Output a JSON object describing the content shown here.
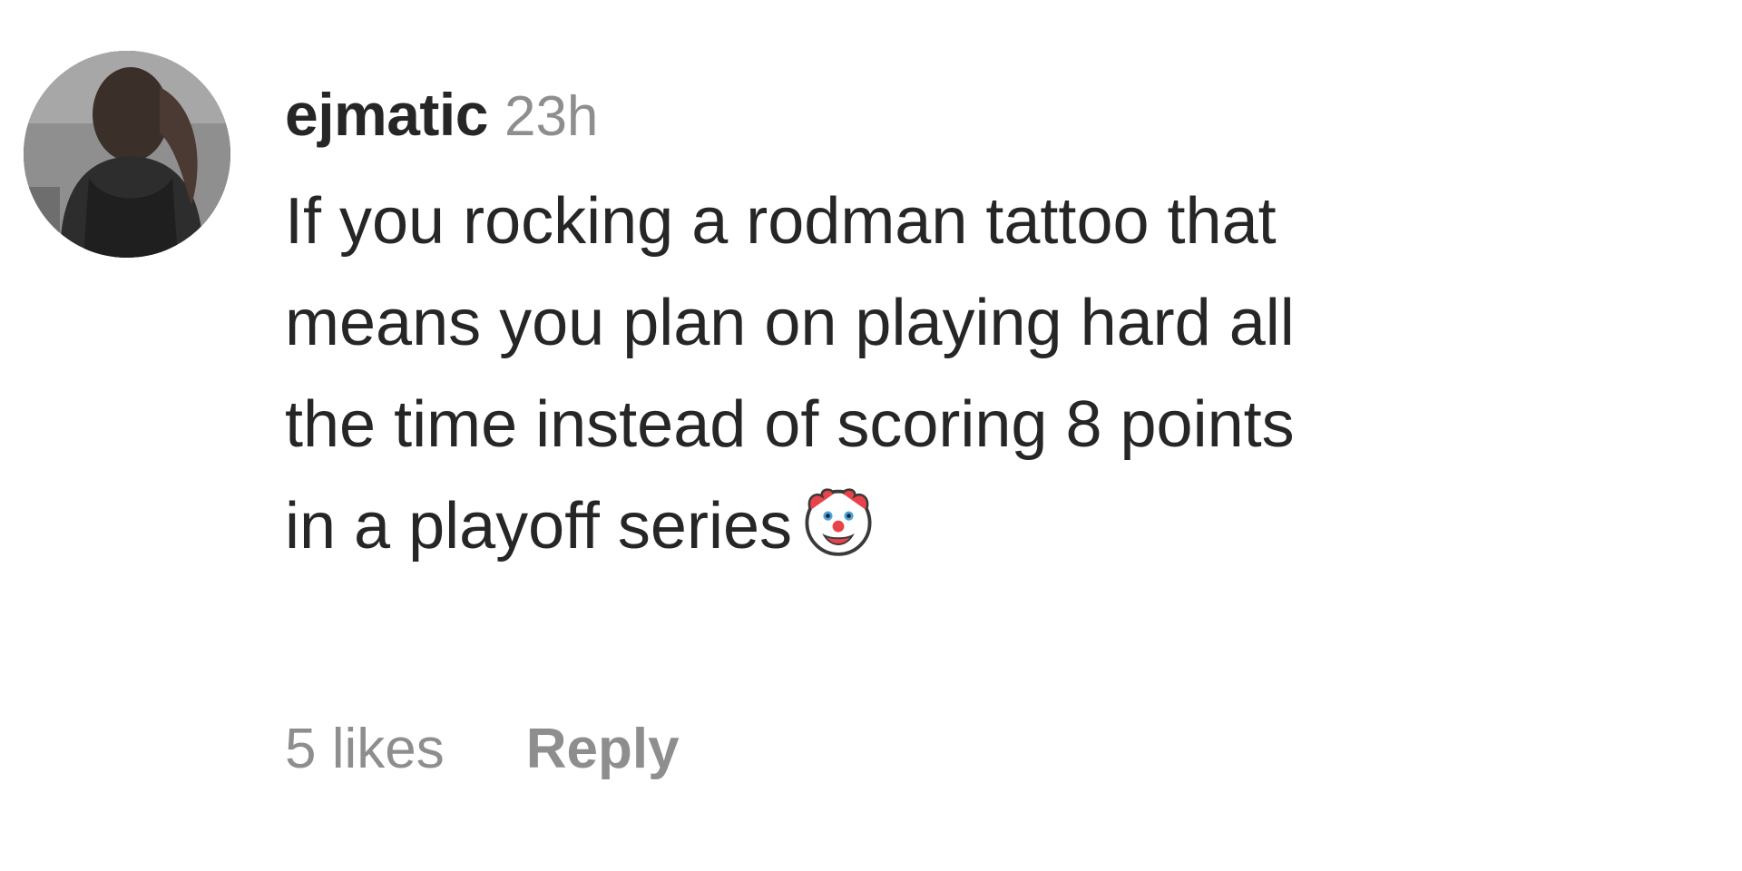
{
  "comment": {
    "username": "ejmatic",
    "timestamp": "23h",
    "body_lines": [
      "If you rocking a rodman tattoo that",
      "means you plan on playing hard all",
      "the time instead of scoring 8 points",
      "in a playoff series"
    ],
    "emoji": "clown-face-emoji",
    "likes_label": "5 likes",
    "reply_label": "Reply"
  },
  "colors": {
    "text_primary": "#262626",
    "text_secondary": "#8e8e8e",
    "background": "#ffffff"
  }
}
